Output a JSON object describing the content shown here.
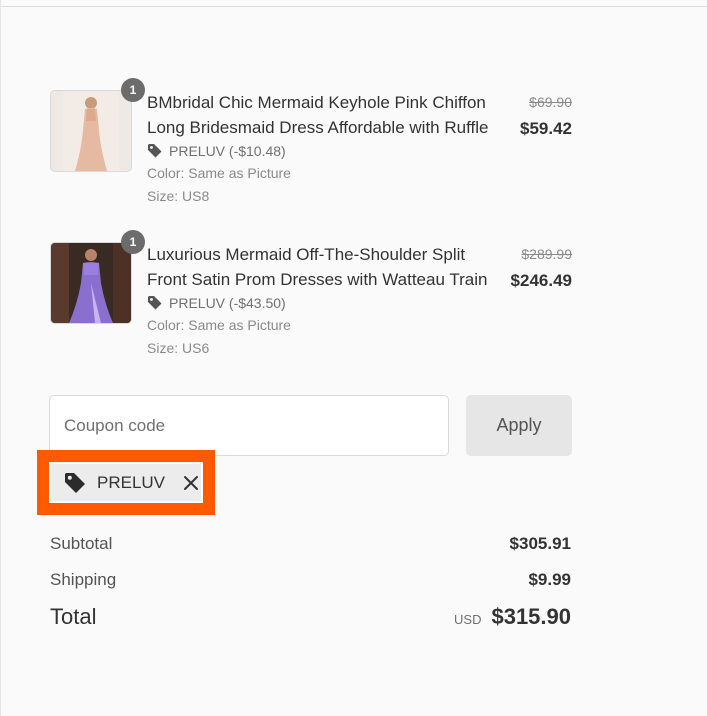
{
  "items": [
    {
      "quantity": "1",
      "title": "BMbridal Chic Mermaid Keyhole Pink Chiffon Long Bridesmaid Dress Affordable with Ruffle",
      "discount": "PRELUV (-$10.48)",
      "color_label": "Color:",
      "color_value": "Same as Picture",
      "size_label": "Size:",
      "size_value": "US8",
      "original_price": "$69.90",
      "price": "$59.42"
    },
    {
      "quantity": "1",
      "title": "Luxurious Mermaid Off-The-Shoulder Split Front Satin Prom Dresses with Watteau Train",
      "discount": "PRELUV (-$43.50)",
      "color_label": "Color:",
      "color_value": "Same as Picture",
      "size_label": "Size:",
      "size_value": "US6",
      "original_price": "$289.99",
      "price": "$246.49"
    }
  ],
  "coupon": {
    "placeholder": "Coupon code",
    "value": "",
    "apply_label": "Apply",
    "applied_code": "PRELUV"
  },
  "totals": {
    "subtotal_label": "Subtotal",
    "subtotal_value": "$305.91",
    "shipping_label": "Shipping",
    "shipping_value": "$9.99",
    "total_label": "Total",
    "currency": "USD",
    "total_value": "$315.90"
  },
  "colors": {
    "highlight": "#ff5a00",
    "badge": "#6c6c6c",
    "apply_button_bg": "#e6e6e6"
  }
}
